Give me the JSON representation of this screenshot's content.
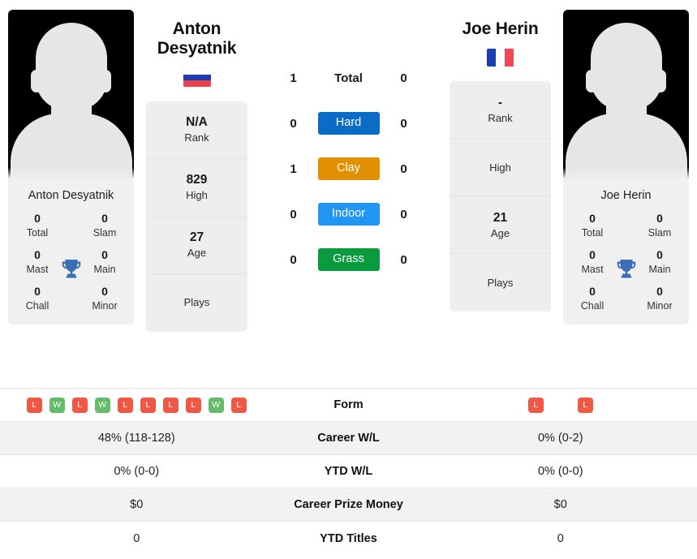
{
  "players": {
    "left": {
      "name_heading": "Anton Desyatnik",
      "photo_caption": "Anton Desyatnik",
      "country": "Russia",
      "flag_colors": [
        "#ffffff",
        "#1b3fb0",
        "#e8434a"
      ],
      "flag_orientation": "horizontal",
      "titles": [
        {
          "value": "0",
          "label": "Total"
        },
        {
          "value": "0",
          "label": "Slam"
        },
        {
          "value": "0",
          "label": "Mast"
        },
        {
          "value": "0",
          "label": "Main"
        },
        {
          "value": "0",
          "label": "Chall"
        },
        {
          "value": "0",
          "label": "Minor"
        }
      ],
      "mini_stats": [
        {
          "value": "N/A",
          "label": "Rank"
        },
        {
          "value": "829",
          "label": "High"
        },
        {
          "value": "27",
          "label": "Age"
        },
        {
          "value": "",
          "label": "Plays"
        }
      ]
    },
    "right": {
      "name_heading": "Joe Herin",
      "photo_caption": "Joe Herin",
      "country": "France",
      "flag_colors": [
        "#1b3fb0",
        "#ffffff",
        "#f04757"
      ],
      "flag_orientation": "vertical",
      "titles": [
        {
          "value": "0",
          "label": "Total"
        },
        {
          "value": "0",
          "label": "Slam"
        },
        {
          "value": "0",
          "label": "Mast"
        },
        {
          "value": "0",
          "label": "Main"
        },
        {
          "value": "0",
          "label": "Chall"
        },
        {
          "value": "0",
          "label": "Minor"
        }
      ],
      "mini_stats": [
        {
          "value": "-",
          "label": "Rank"
        },
        {
          "value": "",
          "label": "High"
        },
        {
          "value": "21",
          "label": "Age"
        },
        {
          "value": "",
          "label": "Plays"
        }
      ]
    }
  },
  "head_to_head": {
    "total": {
      "left": "1",
      "label": "Total",
      "right": "0"
    },
    "surfaces": [
      {
        "left": "0",
        "label": "Hard",
        "right": "0",
        "color": "#0a6cc4"
      },
      {
        "left": "1",
        "label": "Clay",
        "right": "0",
        "color": "#e09000"
      },
      {
        "left": "0",
        "label": "Indoor",
        "right": "0",
        "color": "#2196f3"
      },
      {
        "left": "0",
        "label": "Grass",
        "right": "0",
        "color": "#0a9b3f"
      }
    ]
  },
  "stats_table": {
    "rows": [
      {
        "label": "Form",
        "type": "form",
        "left_form": [
          "L",
          "W",
          "L",
          "W",
          "L",
          "L",
          "L",
          "L",
          "W",
          "L"
        ],
        "right_form": [
          "L",
          "L"
        ]
      },
      {
        "label": "Career W/L",
        "type": "text",
        "left": "48% (118-128)",
        "right": "0% (0-2)"
      },
      {
        "label": "YTD W/L",
        "type": "text",
        "left": "0% (0-0)",
        "right": "0% (0-0)"
      },
      {
        "label": "Career Prize Money",
        "type": "text",
        "left": "$0",
        "right": "$0"
      },
      {
        "label": "YTD Titles",
        "type": "text",
        "left": "0",
        "right": "0"
      }
    ]
  },
  "colors": {
    "win_badge": "#66bb6a",
    "loss_badge": "#ef5844",
    "trophy": "#3a6fb7",
    "card_bg": "#eeeeee",
    "row_alt_bg": "#f2f2f2"
  }
}
